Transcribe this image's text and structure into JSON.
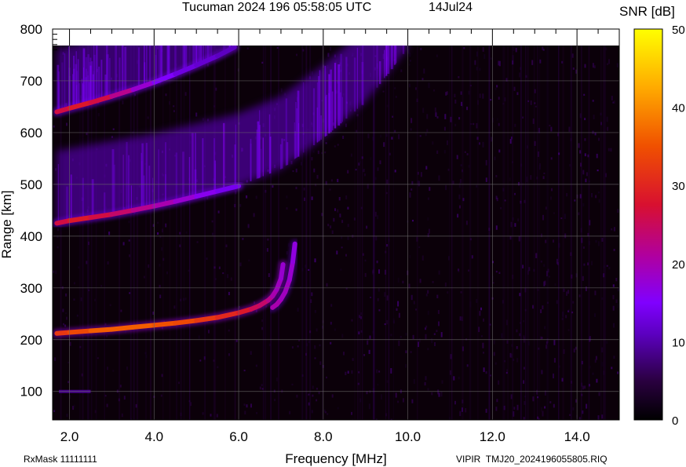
{
  "header": {
    "title": "Tucuman 2024 196 05:58:05 UTC",
    "date": "14Jul24"
  },
  "footer": {
    "rxmask": "RxMask 11111111",
    "file": "VIPIR  TMJ20_2024196055805.RIQ"
  },
  "chart_data": {
    "type": "heatmap",
    "title": "Tucuman 2024 196 05:58:05 UTC",
    "xlabel": "Frequency [MHz]",
    "ylabel": "Range [km]",
    "xlim": [
      1.6,
      15.0
    ],
    "ylim": [
      45,
      800
    ],
    "x_ticks": [
      2.0,
      4.0,
      6.0,
      8.0,
      10.0,
      12.0,
      14.0
    ],
    "x_tick_labels": [
      "2.0",
      "4.0",
      "6.0",
      "8.0",
      "10.0",
      "12.0",
      "14.0"
    ],
    "y_ticks": [
      100,
      200,
      300,
      400,
      500,
      600,
      700,
      800
    ],
    "y_tick_labels": [
      "100",
      "200",
      "300",
      "400",
      "500",
      "600",
      "700",
      "800"
    ],
    "grid": true,
    "colorbar": {
      "label": "SNR [dB]",
      "range": [
        0,
        50
      ],
      "ticks": [
        0,
        10,
        20,
        30,
        40,
        50
      ],
      "tick_labels": [
        "0",
        "10",
        "20",
        "30",
        "40",
        "50"
      ]
    },
    "traces": [
      {
        "name": "",
        "x": [
          1.7,
          2.0,
          2.5,
          3.0,
          3.5,
          4.0,
          4.5,
          5.0,
          5.5,
          6.0,
          6.3,
          6.5,
          6.7,
          6.8,
          6.9,
          7.0,
          7.05
        ],
        "y": [
          212,
          214,
          217,
          220,
          224,
          228,
          232,
          237,
          243,
          252,
          259,
          266,
          276,
          284,
          297,
          318,
          345
        ],
        "snr": [
          32,
          34,
          36,
          36,
          36,
          35,
          34,
          32,
          30,
          28,
          25,
          24,
          22,
          20,
          19,
          18,
          16
        ]
      },
      {
        "name": "",
        "x": [
          6.8,
          6.9,
          7.0,
          7.1,
          7.2,
          7.28,
          7.33
        ],
        "y": [
          262,
          268,
          278,
          292,
          315,
          350,
          385
        ],
        "snr": [
          20,
          20,
          19,
          19,
          18,
          17,
          15
        ]
      },
      {
        "name": "",
        "x": [
          1.7,
          2.0,
          2.5,
          3.0,
          3.5,
          4.0,
          4.5,
          5.0,
          5.5,
          6.0
        ],
        "y": [
          425,
          430,
          436,
          442,
          450,
          458,
          467,
          477,
          487,
          497
        ],
        "snr": [
          26,
          28,
          26,
          24,
          22,
          20,
          18,
          16,
          14,
          12
        ]
      },
      {
        "name": "",
        "x": [
          1.7,
          2.0,
          2.5,
          3.0,
          3.5,
          4.0,
          4.5,
          5.0,
          5.5,
          5.9
        ],
        "y": [
          640,
          647,
          658,
          670,
          683,
          697,
          713,
          730,
          748,
          765
        ],
        "snr": [
          26,
          28,
          26,
          22,
          18,
          15,
          13,
          12,
          11,
          10
        ]
      }
    ],
    "diffuse_regions": [
      {
        "name": "",
        "lower_edge": [
          [
            1.7,
            425
          ],
          [
            4.0,
            458
          ],
          [
            6.0,
            497
          ],
          [
            7.0,
            530
          ],
          [
            8.0,
            590
          ],
          [
            9.0,
            660
          ],
          [
            10.0,
            765
          ]
        ],
        "thickness_km": 140,
        "snr": 12
      },
      {
        "name": "",
        "lower_edge": [
          [
            1.7,
            640
          ],
          [
            3.0,
            670
          ],
          [
            4.5,
            713
          ],
          [
            5.9,
            765
          ]
        ],
        "thickness_km": 120,
        "snr": 11
      }
    ],
    "weak_echo": {
      "x": [
        1.75,
        2.5
      ],
      "y": 100,
      "snr": 10
    }
  }
}
